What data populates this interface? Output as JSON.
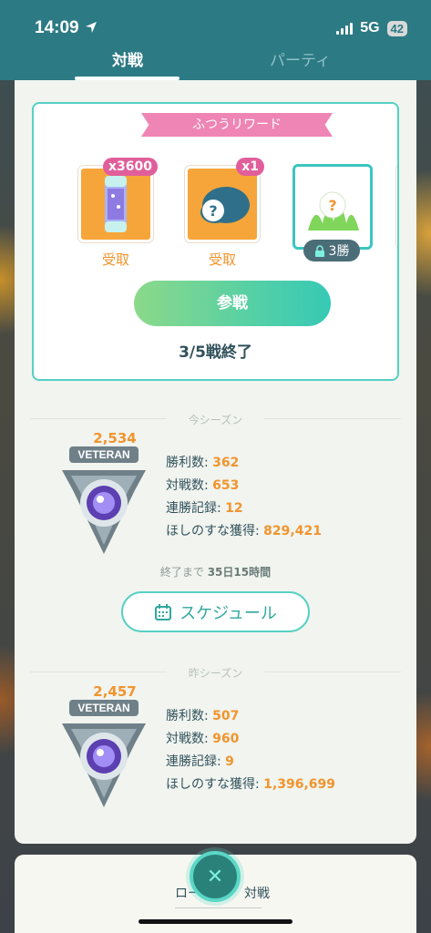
{
  "status": {
    "time": "14:09",
    "network": "5G",
    "battery": "42"
  },
  "tabs": [
    {
      "label": "対戦"
    },
    {
      "label": "パーティ"
    }
  ],
  "rewards": {
    "ribbon": "ふつうリワード",
    "items": [
      {
        "count": "x3600",
        "state": "受取",
        "icon": "stardust-canister-icon"
      },
      {
        "count": "x1",
        "state": "受取",
        "icon": "mystery-encounter-icon"
      },
      {
        "lock_label": "3勝",
        "icon": "mystery-grass-icon"
      }
    ],
    "battle_button": "参戦",
    "battle_status": "3/5戦終了"
  },
  "current_season": {
    "heading": "今シーズン",
    "rating": "2,534",
    "rank": "VETERAN",
    "stats": [
      {
        "label": "勝利数: ",
        "value": "362"
      },
      {
        "label": "対戦数: ",
        "value": "653"
      },
      {
        "label": "連勝記録: ",
        "value": "12"
      },
      {
        "label": "ほしのすな獲得: ",
        "value": "829,421"
      }
    ],
    "time_left_prefix": "終了まで ",
    "time_left": "35日15時間",
    "schedule_button": "スケジュール"
  },
  "previous_season": {
    "heading": "昨シーズン",
    "rating": "2,457",
    "rank": "VETERAN",
    "stats": [
      {
        "label": "勝利数: ",
        "value": "507"
      },
      {
        "label": "対戦数: ",
        "value": "960"
      },
      {
        "label": "連勝記録: ",
        "value": "9"
      },
      {
        "label": "ほしのすな獲得: ",
        "value": "1,396,699"
      }
    ]
  },
  "bottom": {
    "label_left": "ロー",
    "label_right": "対戦"
  },
  "colors": {
    "accent": "#56d0c4",
    "orange": "#f1942d",
    "header": "#2c7a84",
    "pink": "#ef85b5"
  }
}
